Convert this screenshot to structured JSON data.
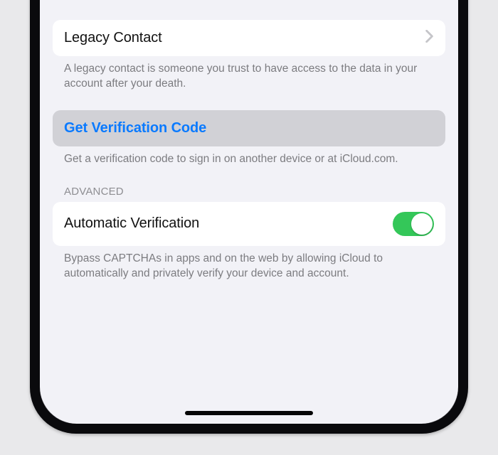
{
  "sections": {
    "legacy": {
      "title": "Legacy Contact",
      "footer": "A legacy contact is someone you trust to have access to the data in your account after your death."
    },
    "verification": {
      "button": "Get Verification Code",
      "footer": "Get a verification code to sign in on another device or at iCloud.com."
    },
    "advanced": {
      "header": "ADVANCED",
      "autoVerification": {
        "title": "Automatic Verification",
        "enabled": true,
        "footer": "Bypass CAPTCHAs in apps and on the web by allowing iCloud to automatically and privately verify your device and account."
      }
    }
  },
  "colors": {
    "accent": "#0a7aff",
    "toggleOn": "#34c759",
    "background": "#f2f2f7"
  }
}
